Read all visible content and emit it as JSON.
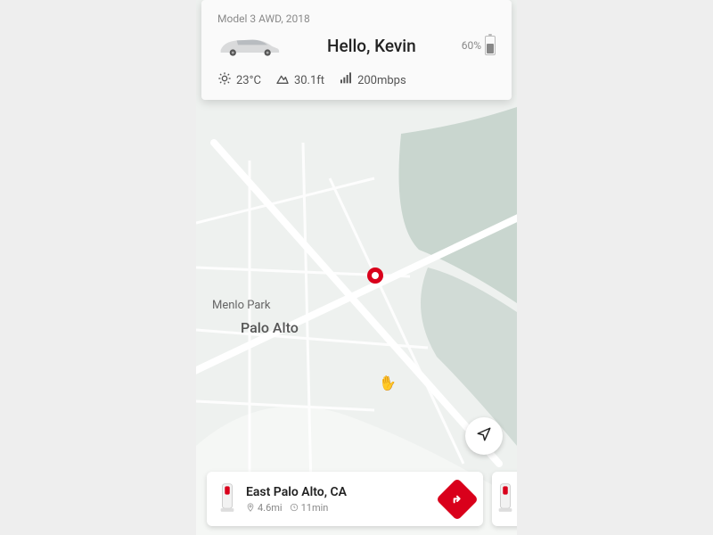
{
  "vehicle": {
    "model_line": "Model 3 AWD, 2018",
    "greeting": "Hello, Kevin",
    "battery_percent_label": "60%",
    "battery_fill_pct": 60
  },
  "metrics": {
    "temp": "23°C",
    "elevation": "30.1ft",
    "signal": "200mbps"
  },
  "map": {
    "label_menlo": "Menlo Park",
    "label_palo": "Palo Alto"
  },
  "charger": {
    "title": "East Palo Alto, CA",
    "distance": "4.6mi",
    "time": "11min"
  },
  "colors": {
    "accent": "#d9001b"
  }
}
